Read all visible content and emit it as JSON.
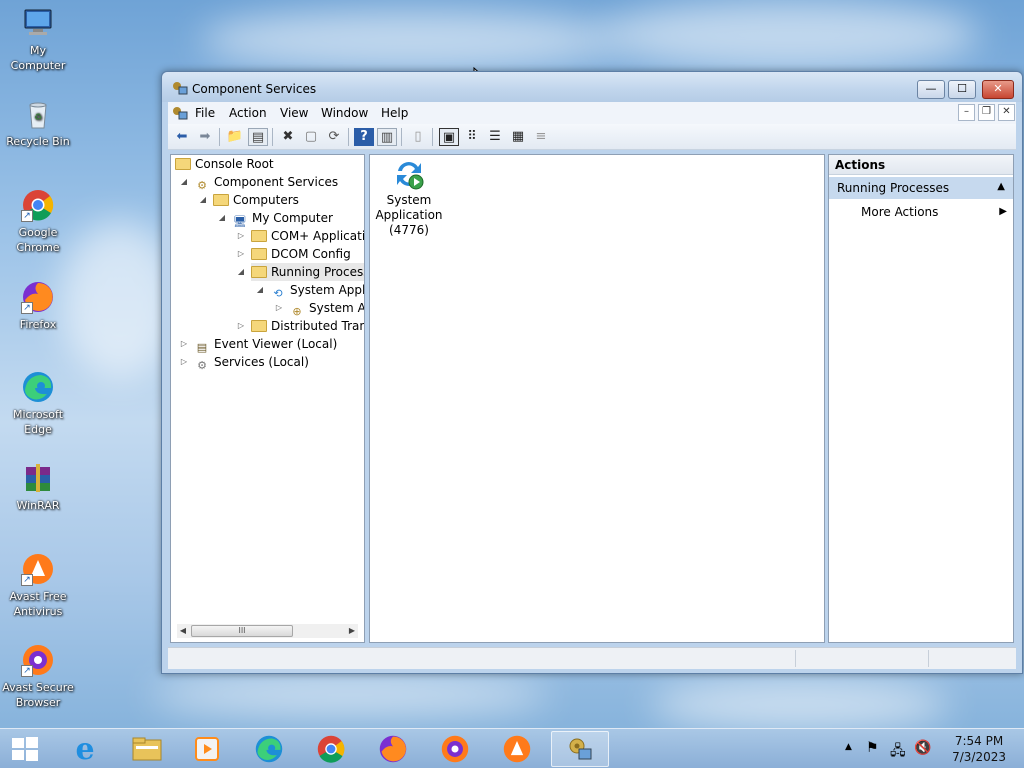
{
  "desktop": {
    "icons": [
      {
        "label": "My Computer",
        "icon": "computer-icon"
      },
      {
        "label": "Recycle Bin",
        "icon": "recycle-bin-icon"
      },
      {
        "label": "Google Chrome",
        "icon": "chrome-icon"
      },
      {
        "label": "Firefox",
        "icon": "firefox-icon"
      },
      {
        "label": "Microsoft Edge",
        "icon": "edge-icon"
      },
      {
        "label": "WinRAR",
        "icon": "winrar-icon"
      },
      {
        "label": "Avast Free Antivirus",
        "icon": "avast-icon"
      },
      {
        "label": "Avast Secure Browser",
        "icon": "avast-browser-icon"
      }
    ]
  },
  "window": {
    "title": "Component Services",
    "controls": {
      "minimize": "—",
      "maximize": "☐",
      "close": "✕"
    }
  },
  "menu": {
    "items": [
      "File",
      "Action",
      "View",
      "Window",
      "Help"
    ],
    "mdi": {
      "minimize": "–",
      "restore": "❐",
      "close": "✕"
    }
  },
  "toolbar": {
    "buttons": [
      "back",
      "forward",
      "up-folder",
      "show-hide-tree",
      "delete",
      "properties",
      "refresh",
      "help",
      "show-hide-action",
      "export",
      "large-icons",
      "small-icons",
      "list",
      "details",
      "status-view"
    ]
  },
  "tree": {
    "nodes": [
      {
        "label": "Console Root",
        "icon": "folder-icon",
        "expander": ""
      },
      {
        "label": "Component Services",
        "icon": "component-services-icon",
        "expander": "◢"
      },
      {
        "label": "Computers",
        "icon": "folder-icon",
        "expander": "◢"
      },
      {
        "label": "My Computer",
        "icon": "my-computer-icon",
        "expander": "◢"
      },
      {
        "label": "COM+ Applications",
        "icon": "folder-icon",
        "expander": "▷"
      },
      {
        "label": "DCOM Config",
        "icon": "folder-icon",
        "expander": "▷"
      },
      {
        "label": "Running Processes",
        "icon": "folder-icon",
        "expander": "◢"
      },
      {
        "label": "System Application",
        "icon": "process-icon",
        "expander": "◢"
      },
      {
        "label": "System Application",
        "icon": "com-app-icon",
        "expander": "▷"
      },
      {
        "label": "Distributed Transaction Coordinator",
        "icon": "folder-icon",
        "expander": "▷"
      },
      {
        "label": "Event Viewer (Local)",
        "icon": "event-viewer-icon",
        "expander": "▷"
      },
      {
        "label": "Services (Local)",
        "icon": "services-icon",
        "expander": "▷"
      }
    ],
    "scrollbar_thumb": "III"
  },
  "main": {
    "item": {
      "line1": "System",
      "line2": "Application",
      "line3": "(4776)"
    }
  },
  "actions": {
    "header": "Actions",
    "section": "Running Processes",
    "section_toggle": "▲",
    "item": "More Actions",
    "item_arrow": "▶"
  },
  "taskbar": {
    "apps": [
      "start",
      "internet-explorer",
      "file-explorer",
      "media-player",
      "edge",
      "chrome",
      "firefox",
      "avast-browser",
      "avast",
      "component-services"
    ],
    "tray_arrow": "▲",
    "time": "7:54 PM",
    "date": "7/3/2023"
  },
  "colors": {
    "window_frame": "#bcd3ec",
    "selection": "#c6d9ee",
    "close_button": "#c74632"
  }
}
